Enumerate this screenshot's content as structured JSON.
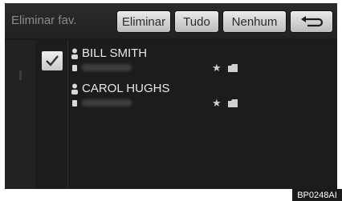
{
  "header": {
    "title": "Eliminar fav.",
    "buttons": {
      "delete_label": "Eliminar",
      "all_label": "Tudo",
      "none_label": "Nenhum",
      "back_icon": "return-arrow-icon"
    }
  },
  "list": {
    "items": [
      {
        "name": "BILL SMITH",
        "checked": true,
        "icons": [
          "person-icon",
          "phone-icon",
          "star-icon",
          "folder-icon"
        ]
      },
      {
        "name": "CAROL HUGHS",
        "checked": false,
        "icons": [
          "person-icon",
          "phone-icon",
          "star-icon",
          "folder-icon"
        ]
      }
    ]
  },
  "footer": {
    "code": "BP0248AI"
  },
  "colors": {
    "screen_bg": "#1a1a1a",
    "button_bg": "#dcdcdc",
    "text": "#e8e8e8"
  }
}
